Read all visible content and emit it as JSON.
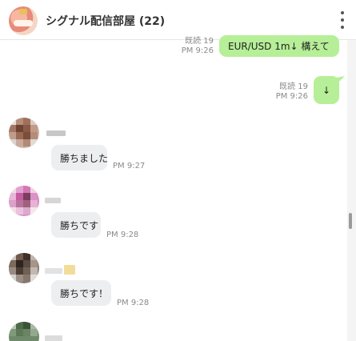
{
  "header": {
    "title": "シグナル配信部屋 (22)",
    "menu_icon": "kebab-menu-icon"
  },
  "messages_sent": [
    {
      "text": "EUR/USD 1m↓  構えて",
      "read": "既読 19",
      "time": "PM 9:26"
    },
    {
      "text": "↓",
      "read": "既読 19",
      "time": "PM 9:26"
    }
  ],
  "messages_received": [
    {
      "text": "勝ちました",
      "time": "PM 9:27"
    },
    {
      "text": "勝ちです",
      "time": "PM 9:28"
    },
    {
      "text": "勝ちです！",
      "time": "PM 9:28"
    }
  ],
  "colors": {
    "sent_bubble": "#b6ef97",
    "received_bubble": "#edeef0",
    "meta_text": "#8a8a8a"
  }
}
